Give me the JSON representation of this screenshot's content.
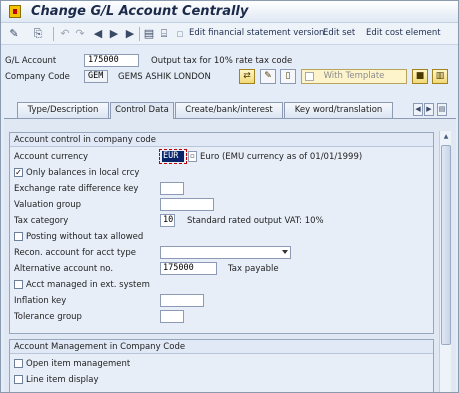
{
  "window": {
    "title": "Change G/L Account Centrally"
  },
  "toolbar": {
    "links": [
      "Edit financial statement version",
      "Edit set",
      "Edit cost element"
    ]
  },
  "header": {
    "gl_account_label": "G/L Account",
    "gl_account_value": "175000",
    "gl_account_desc": "Output tax for 10% rate tax code",
    "company_code_label": "Company Code",
    "company_code_value": "GEM",
    "company_code_desc": "GEMS ASHIK LONDON",
    "with_template_label": "With Template"
  },
  "tabs": [
    {
      "label": "Type/Description",
      "active": false
    },
    {
      "label": "Control Data",
      "active": true
    },
    {
      "label": "Create/bank/interest",
      "active": false
    },
    {
      "label": "Key word/translation",
      "active": false
    }
  ],
  "account_control": {
    "title": "Account control in company code",
    "account_currency_label": "Account currency",
    "account_currency_value": "EUR",
    "account_currency_desc": "Euro (EMU currency as of 01/01/1999)",
    "only_balances_label": "Only balances in local crcy",
    "only_balances_checked": true,
    "exchange_rate_label": "Exchange rate difference key",
    "valuation_group_label": "Valuation group",
    "tax_category_label": "Tax category",
    "tax_category_value": "10",
    "tax_category_desc": "Standard rated output VAT: 10%",
    "posting_without_tax_label": "Posting without tax allowed",
    "recon_account_label": "Recon. account for acct type",
    "alt_account_label": "Alternative account no.",
    "alt_account_value": "175000",
    "alt_account_desc": "Tax payable",
    "acct_managed_label": "Acct managed in ext. system",
    "inflation_key_label": "Inflation key",
    "tolerance_group_label": "Tolerance group"
  },
  "account_management": {
    "title": "Account Management in Company Code",
    "open_item_label": "Open item management",
    "line_item_label": "Line item display"
  },
  "colors": {
    "accent": "#0a246a",
    "panel": "#dfe8f3",
    "template_button": "#fdf4cc"
  }
}
